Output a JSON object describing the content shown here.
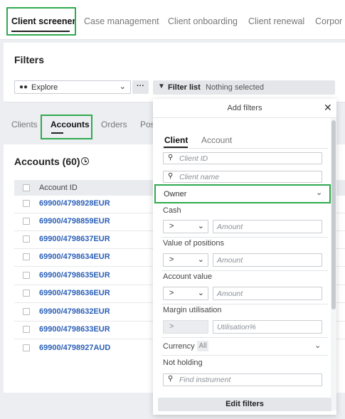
{
  "top_tabs": [
    "Client screener",
    "Case management",
    "Client onboarding",
    "Client renewal",
    "Corpor"
  ],
  "filters": {
    "title": "Filters",
    "explore_label": "Explore",
    "more_label": "···",
    "filter_list_label": "Filter list",
    "filter_list_value": "Nothing selected"
  },
  "sub_tabs": [
    "Clients",
    "Accounts",
    "Orders",
    "Pos"
  ],
  "accounts": {
    "title": "Accounts (60)",
    "column_header": "Account ID",
    "rows": [
      "69900/4798928EUR",
      "69900/4798859EUR",
      "69900/4798637EUR",
      "69900/4798634EUR",
      "69900/4798635EUR",
      "69900/4798636EUR",
      "69900/4798632EUR",
      "69900/4798633EUR",
      "69900/4798927AUD"
    ]
  },
  "add_filters": {
    "title": "Add filters",
    "tabs": [
      "Client",
      "Account"
    ],
    "client_id_placeholder": "Client ID",
    "client_name_placeholder": "Client name",
    "owner_label": "Owner",
    "cash_label": "Cash",
    "cash_op": ">",
    "cash_placeholder": "Amount",
    "positions_label": "Value of positions",
    "positions_op": ">",
    "positions_placeholder": "Amount",
    "account_value_label": "Account value",
    "account_value_op": ">",
    "account_value_placeholder": "Amount",
    "margin_label": "Margin utilisation",
    "margin_op": ">",
    "margin_placeholder": "Utilisation%",
    "currency_label": "Currency",
    "currency_value": "All",
    "not_holding_label": "Not holding",
    "instrument_placeholder": "Find instrument",
    "edit_button": "Edit filters"
  },
  "colors": {
    "highlight": "#2eaa4f",
    "link": "#2a5fb8"
  }
}
